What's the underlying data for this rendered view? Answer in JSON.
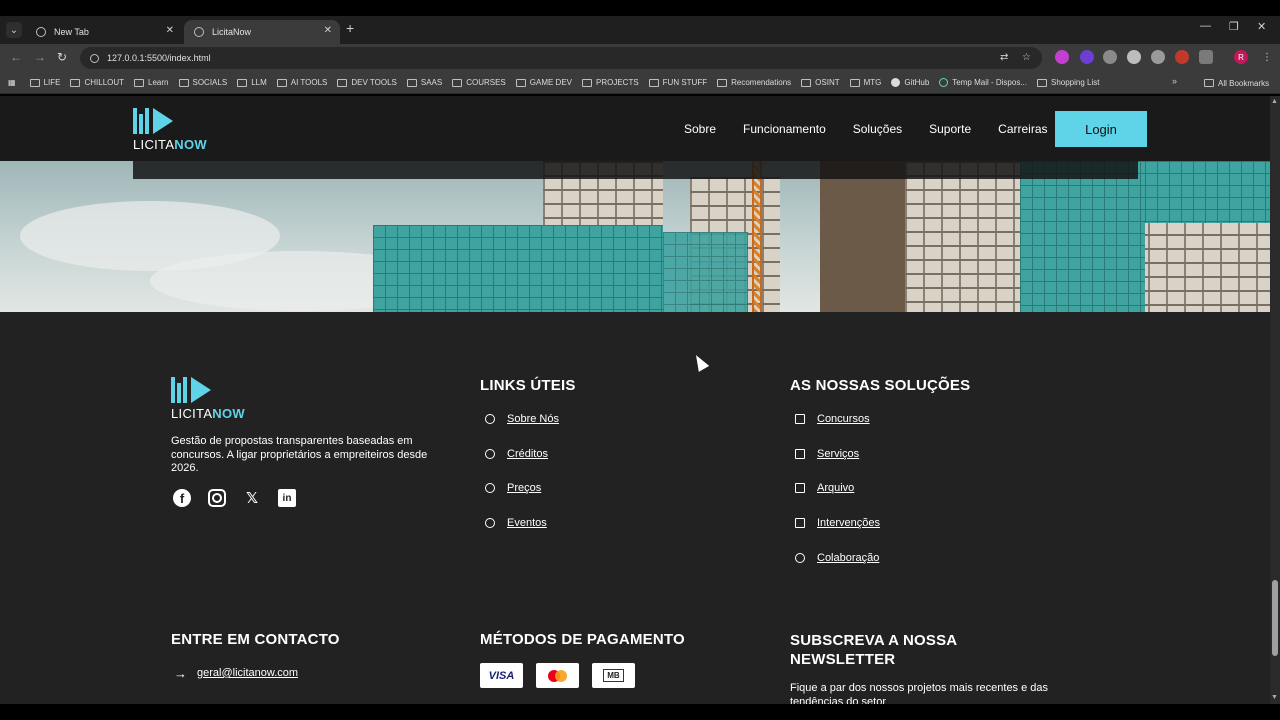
{
  "browser": {
    "tabs": [
      {
        "title": "New Tab"
      },
      {
        "title": "LicitaNow"
      }
    ],
    "url": "127.0.0.1:5500/index.html",
    "bookmarks": [
      "LIFE",
      "CHILLOUT",
      "Learn",
      "SOCIALS",
      "LLM",
      "AI TOOLS",
      "DEV TOOLS",
      "SAAS",
      "COURSES",
      "GAME DEV",
      "PROJECTS",
      "FUN STUFF",
      "Recomendations",
      "OSINT",
      "MTG",
      "GitHub",
      "Temp Mail - Dispos...",
      "Shopping List"
    ],
    "all_bookmarks": "All Bookmarks",
    "profile_initial": "R"
  },
  "site": {
    "logo_left": "LICITA",
    "logo_right": "NOW",
    "nav": [
      "Sobre",
      "Funcionamento",
      "Soluções",
      "Suporte",
      "Carreiras"
    ],
    "login": "Login"
  },
  "footer": {
    "description": "Gestão de propostas transparentes baseadas em concursos. A ligar proprietários a empreiteiros desde 2026.",
    "links_title": "LINKS ÚTEIS",
    "links": [
      "Sobre Nós",
      "Créditos",
      "Preços",
      "Eventos"
    ],
    "solutions_title": "AS NOSSAS SOLUÇÕES",
    "solutions": [
      "Concursos",
      "Serviços",
      "Arquivo",
      "Intervenções",
      "Colaboração"
    ],
    "contact_title": "ENTRE EM CONTACTO",
    "contact_email": "geral@licitanow.com",
    "payment_title": "MÉTODOS DE PAGAMENTO",
    "payment_visa": "VISA",
    "payment_mb": "MB",
    "newsletter_title": "SUBSCREVA A NOSSA NEWSLETTER",
    "newsletter_text": "Fique a par dos nossos projetos mais recentes e das tendências do setor"
  },
  "colors": {
    "accent": "#5fd4e8",
    "footer_bg": "#222222",
    "header_bg": "#1a1a1a"
  }
}
